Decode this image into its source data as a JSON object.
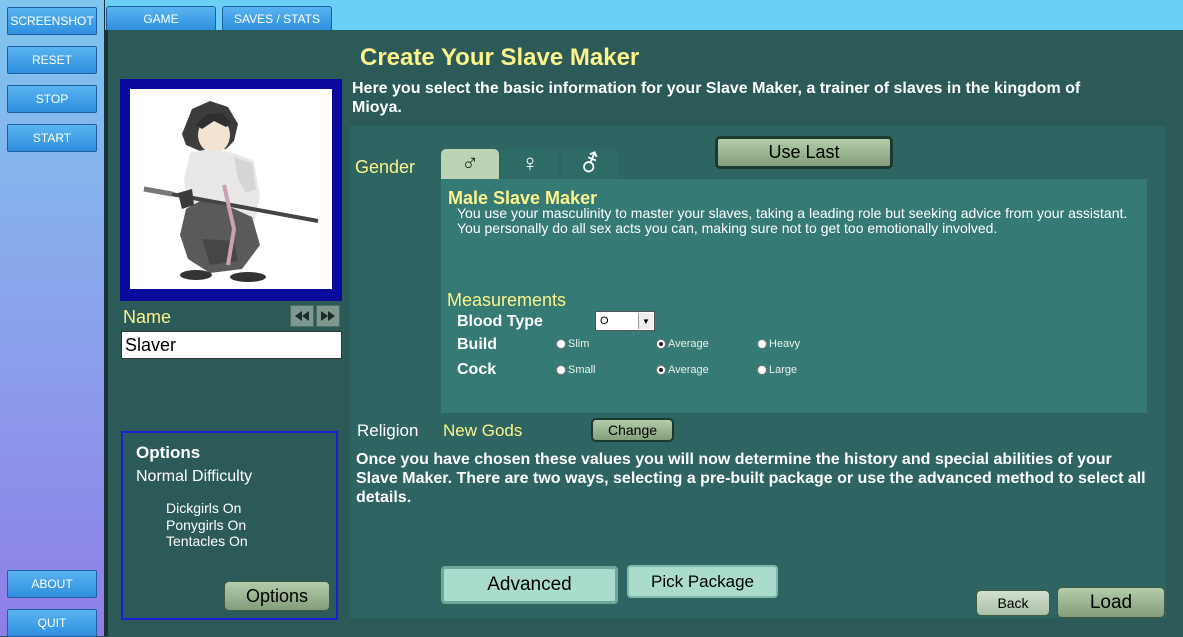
{
  "sidebar": {
    "buttons_top": [
      {
        "label": "SCREENSHOT"
      },
      {
        "label": "RESET"
      },
      {
        "label": "STOP"
      },
      {
        "label": "START"
      }
    ],
    "buttons_bottom": [
      {
        "label": "ABOUT"
      },
      {
        "label": "QUIT"
      }
    ]
  },
  "tabs": [
    {
      "label": "GAME"
    },
    {
      "label": "SAVES / STATS"
    }
  ],
  "header": {
    "title": "Create Your Slave Maker",
    "intro": "Here you select the basic information for your Slave Maker, a trainer of slaves in the kingdom of Mioya."
  },
  "character": {
    "name_label": "Name",
    "name_value": "Slaver"
  },
  "options": {
    "title": "Options",
    "difficulty": "Normal Difficulty",
    "items": [
      "Dickgirls On",
      "Ponygirls On",
      "Tentacles On"
    ],
    "button_label": "Options"
  },
  "gender": {
    "label": "Gender",
    "tabs": [
      {
        "symbol": "♂",
        "active": true
      },
      {
        "symbol": "♀",
        "active": false
      },
      {
        "symbol": "⚦",
        "active": false
      }
    ],
    "use_last_label": "Use Last",
    "selected_title": "Male Slave Maker",
    "selected_description": "You use your masculinity to master your slaves, taking a leading role but seeking advice from your assistant. You personally do all sex acts you can, making sure not to get too emotionally involved."
  },
  "measurements": {
    "title": "Measurements",
    "blood_type": {
      "label": "Blood Type",
      "value": "O"
    },
    "build": {
      "label": "Build",
      "options": [
        "Slim",
        "Average",
        "Heavy"
      ],
      "selected": 1
    },
    "cock": {
      "label": "Cock",
      "options": [
        "Small",
        "Average",
        "Large"
      ],
      "selected": 1
    }
  },
  "religion": {
    "label": "Religion",
    "value": "New Gods",
    "change_label": "Change"
  },
  "instructions": "Once you have chosen these values you will now determine the history and special abilities of your Slave Maker. There are two ways, selecting a pre-built package or use the advanced method to select all details.",
  "actions": {
    "advanced_label": "Advanced",
    "pick_package_label": "Pick Package",
    "back_label": "Back",
    "load_label": "Load"
  }
}
